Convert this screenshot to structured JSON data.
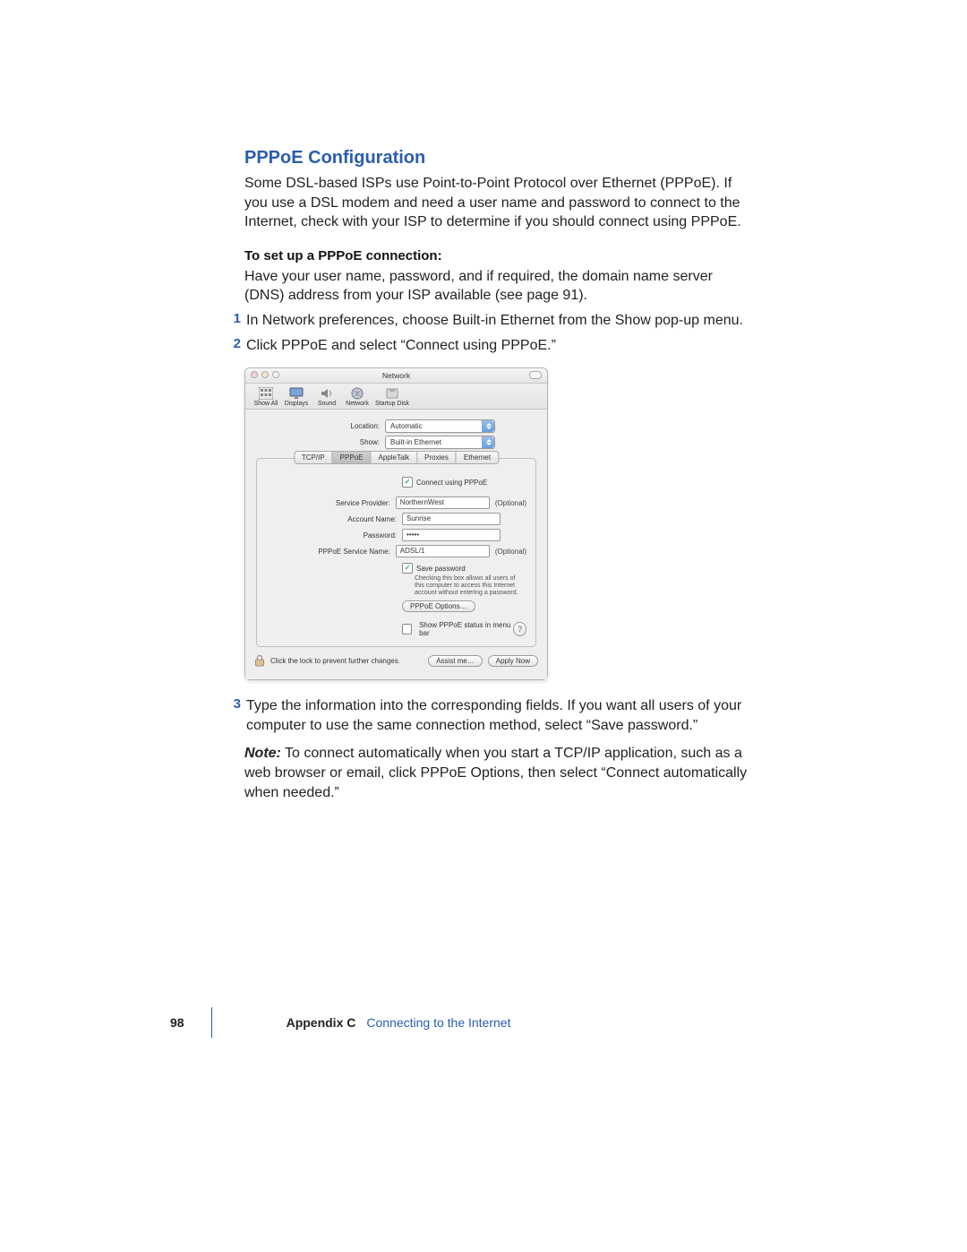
{
  "section": {
    "title": "PPPoE Configuration",
    "intro": "Some DSL-based ISPs use Point-to-Point Protocol over Ethernet (PPPoE). If you use a DSL modem and need a user name and password to connect to the Internet, check with your ISP to determine if you should connect using PPPoE.",
    "subhead": "To set up a PPPoE connection:",
    "prep": "Have your user name, password, and if required, the domain name server (DNS) address from your ISP available (see page 91).",
    "steps": [
      {
        "n": "1",
        "t": "In Network preferences, choose Built-in Ethernet from the Show pop-up menu."
      },
      {
        "n": "2",
        "t": "Click PPPoE and select “Connect using PPPoE.”"
      },
      {
        "n": "3",
        "t": "Type the information into the corresponding fields. If you want all users of your computer to use the same connection method, select “Save password.”"
      }
    ],
    "note_label": "Note:",
    "note": " To connect automatically when you start a TCP/IP application, such as a web browser or email, click PPPoE Options, then select “Connect automatically when needed.”"
  },
  "shot": {
    "window_title": "Network",
    "toolbar": [
      {
        "label": "Show All",
        "icon": "grid"
      },
      {
        "label": "Displays",
        "icon": "display"
      },
      {
        "label": "Sound",
        "icon": "speaker"
      },
      {
        "label": "Network",
        "icon": "globe"
      },
      {
        "label": "Startup Disk",
        "icon": "disk"
      }
    ],
    "location_label": "Location:",
    "location_value": "Automatic",
    "show_label": "Show:",
    "show_value": "Built-in Ethernet",
    "tabs": [
      "TCP/IP",
      "PPPoE",
      "AppleTalk",
      "Proxies",
      "Ethernet"
    ],
    "active_tab": "PPPoE",
    "connect_checkbox": "Connect using PPPoE",
    "fields": {
      "service_provider_label": "Service Provider:",
      "service_provider_value": "NorthernWest",
      "service_provider_opt": "(Optional)",
      "account_name_label": "Account Name:",
      "account_name_value": "Sunrise",
      "password_label": "Password:",
      "password_value": "•••••",
      "pppoe_service_label": "PPPoE Service Name:",
      "pppoe_service_value": "ADSL/1",
      "pppoe_service_opt": "(Optional)"
    },
    "savepw_label": "Save password",
    "savepw_hint": "Checking this box allows all users of this computer to access this Internet account without entering a password.",
    "options_btn": "PPPoE Options…",
    "status_checkbox": "Show PPPoE status in menu bar",
    "help_label": "?",
    "lock_text": "Click the lock to prevent further changes.",
    "assist_btn": "Assist me…",
    "apply_btn": "Apply Now"
  },
  "footer": {
    "page_num": "98",
    "appendix": "Appendix C",
    "title": "Connecting to the Internet"
  }
}
